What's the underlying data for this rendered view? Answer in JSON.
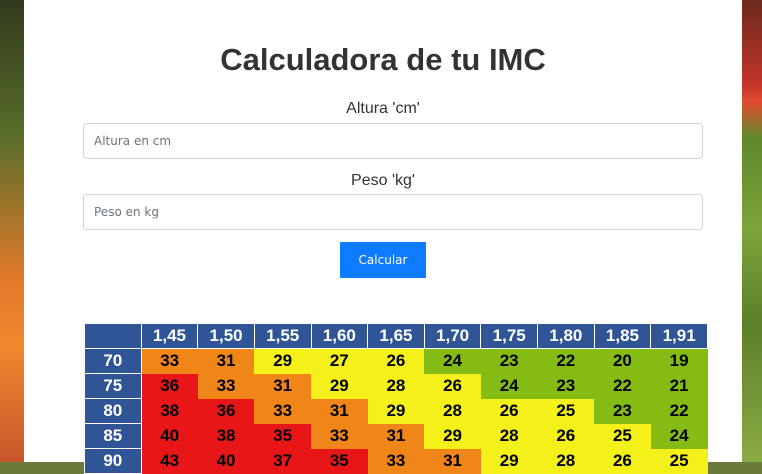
{
  "title": "Calculadora de tu IMC",
  "height_label": "Altura 'cm'",
  "height_placeholder": "Altura en cm",
  "weight_label": "Peso 'kg'",
  "weight_placeholder": "Peso en kg",
  "calculate_label": "Calcular",
  "bmi_table": {
    "heights": [
      "1,45",
      "1,50",
      "1,55",
      "1,60",
      "1,65",
      "1,70",
      "1,75",
      "1,80",
      "1,85",
      "1,91"
    ],
    "rows": [
      {
        "weight": "70",
        "values": [
          33,
          31,
          29,
          27,
          26,
          24,
          23,
          22,
          20,
          19
        ]
      },
      {
        "weight": "75",
        "values": [
          36,
          33,
          31,
          29,
          28,
          26,
          24,
          23,
          22,
          21
        ]
      },
      {
        "weight": "80",
        "values": [
          38,
          36,
          33,
          31,
          29,
          28,
          26,
          25,
          23,
          22
        ]
      },
      {
        "weight": "85",
        "values": [
          40,
          38,
          35,
          33,
          31,
          29,
          28,
          26,
          25,
          24
        ]
      },
      {
        "weight": "90",
        "values": [
          43,
          40,
          37,
          35,
          33,
          31,
          29,
          28,
          26,
          25
        ]
      }
    ],
    "colors": {
      "header": "#2f5597",
      "normal": "#84bc14",
      "overweight": "#f4f01a",
      "obese": "#f08518",
      "severe": "#e81616"
    }
  }
}
